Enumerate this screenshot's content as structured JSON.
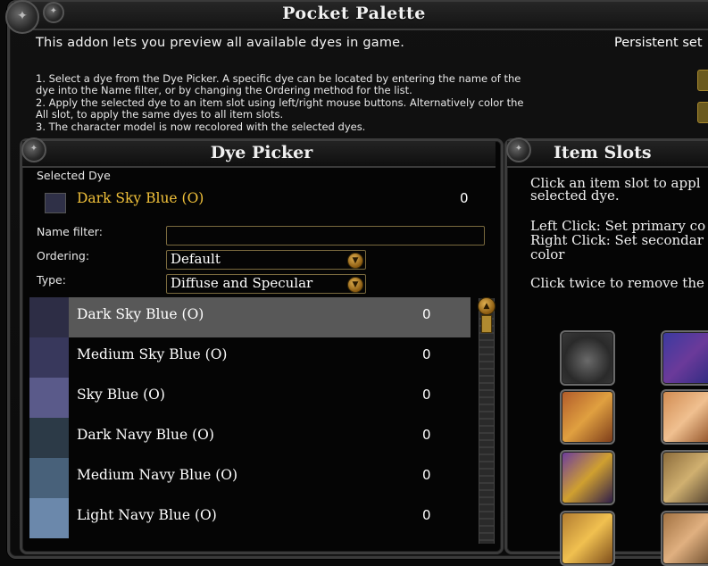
{
  "window": {
    "title": "Pocket Palette",
    "description": "This addon lets you preview all available dyes in game.",
    "persistent_label": "Persistent set",
    "instructions": [
      "1. Select a dye from the Dye Picker. A specific dye can be located by entering the name of the",
      "dye into the Name filter, or by changing the Ordering method for the list.",
      "2. Apply the selected dye to an item slot using left/right mouse buttons. Alternatively color the",
      "All slot, to apply the same dyes to all item slots.",
      "3. The character model is now recolored with the selected dyes."
    ]
  },
  "dye_picker": {
    "title": "Dye Picker",
    "selected_dye_label": "Selected Dye",
    "selected_dye_name": "Dark Sky Blue (O)",
    "selected_dye_count": "0",
    "selected_dye_color": "#2f3047",
    "name_filter_label": "Name filter:",
    "name_filter_value": "",
    "ordering_label": "Ordering:",
    "ordering_value": "Default",
    "type_label": "Type:",
    "type_value": "Diffuse and Specular",
    "dyes": [
      {
        "name": "Dark Sky Blue (O)",
        "count": "0",
        "color": "#2d2d45",
        "selected": true
      },
      {
        "name": "Medium Sky Blue (O)",
        "count": "0",
        "color": "#38385c"
      },
      {
        "name": "Sky Blue (O)",
        "count": "0",
        "color": "#5a5a8a"
      },
      {
        "name": "Dark Navy Blue (O)",
        "count": "0",
        "color": "#2c3a47"
      },
      {
        "name": "Medium Navy Blue (O)",
        "count": "0",
        "color": "#48617a"
      },
      {
        "name": "Light Navy Blue (O)",
        "count": "0",
        "color": "#6b88ab"
      }
    ]
  },
  "item_slots": {
    "title": "Item Slots",
    "help_lines": [
      "Click an item slot to appl",
      "selected dye.",
      "Left Click: Set primary co",
      "Right Click: Set secondar",
      "color",
      "Click twice to remove the"
    ]
  },
  "colors": {
    "accent_gold": "#f2c23a",
    "border_gold": "#7a6a3e",
    "highlight": "#585858"
  }
}
